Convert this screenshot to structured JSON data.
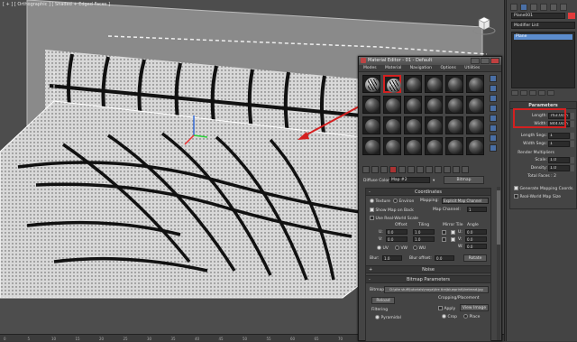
{
  "viewport": {
    "label": "[ + ] [ Orthographic ] [ Shaded + Edged Faces ]",
    "ruler_ticks": [
      "0",
      "5",
      "10",
      "15",
      "20",
      "25",
      "30",
      "35",
      "40",
      "45",
      "50",
      "55",
      "60",
      "65",
      "70",
      "75",
      "80",
      "85",
      "90",
      "95",
      "100"
    ]
  },
  "right_panel": {
    "object_name": "Plane001",
    "object_color": "#e23c3c",
    "modifier_list": "Modifier List",
    "stack_item": "Plane",
    "parameters_title": "Parameters",
    "length_label": "Length:",
    "length_value": "763.0cm",
    "width_label": "Width:",
    "width_value": "844.0cm",
    "length_segs_label": "Length Segs:",
    "length_segs_value": "1",
    "width_segs_label": "Width Segs:",
    "width_segs_value": "1",
    "render_mult_label": "Render Multipliers",
    "scale_label": "Scale:",
    "scale_value": "1.0",
    "density_label": "Density:",
    "density_value": "1.0",
    "total_faces": "Total Faces : 2",
    "gen_mapping": "Generate Mapping Coords.",
    "real_world": "Real-World Map Size"
  },
  "material_editor": {
    "title": "Material Editor - 01 - Default",
    "menu": [
      "Modes",
      "Material",
      "Navigation",
      "Options",
      "Utilities"
    ],
    "diffuse_label": "Diffuse Color:",
    "map_name": "Map #2",
    "map_type": "Bitmap",
    "coordinates_title": "Coordinates",
    "texture_label": "Texture",
    "environ_label": "Environ",
    "mapping_label": "Mapping:",
    "mapping_value": "Explicit Map Channel",
    "show_map_back": "Show Map on Back",
    "map_channel_label": "Map Channel:",
    "map_channel_value": "1",
    "use_real_world": "Use Real-World Scale",
    "offset_label": "Offset",
    "tiling_label": "Tiling",
    "mirror_tile_label": "Mirror Tile",
    "angle_label": "Angle",
    "u_label": "U:",
    "v_label": "V:",
    "w_label": "W:",
    "u_offset": "0.0",
    "v_offset": "0.0",
    "u_tiling": "1.0",
    "v_tiling": "1.0",
    "u_angle": "0.0",
    "v_angle": "0.0",
    "w_angle": "0.0",
    "uv": "UV",
    "vw": "VW",
    "wu": "WU",
    "blur_label": "Blur:",
    "blur_value": "1.0",
    "blur_offset_label": "Blur offset:",
    "blur_offset_value": "0.0",
    "rotate_label": "Rotate",
    "noise_title": "Noise",
    "bitmap_params_title": "Bitmap Parameters",
    "bitmap_label": "Bitmap:",
    "bitmap_path": "D:\\site stuff\\tutorials\\maya\\tire tire\\blueprint\\tiretread.jpg",
    "reload": "Reload",
    "cropping_title": "Cropping/Placement",
    "apply": "Apply",
    "view_image": "View Image",
    "crop": "Crop",
    "place": "Place",
    "filtering": "Filtering",
    "pyramidal": "Pyramidal"
  }
}
